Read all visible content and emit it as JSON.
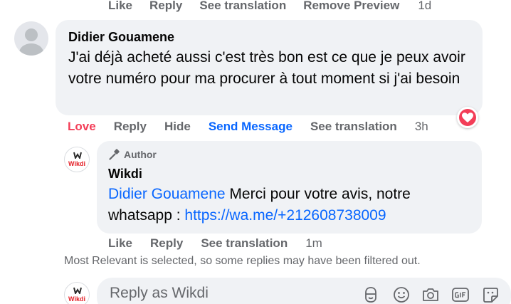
{
  "top_actions": {
    "like": "Like",
    "reply": "Reply",
    "see_translation": "See translation",
    "remove_preview": "Remove Preview",
    "time": "1d"
  },
  "comment": {
    "author": "Didier Gouamene",
    "text": "J'ai déjà acheté aussi c'est très bon est ce que je peux avoir votre numéro pour ma procurer à tout moment si j'ai besoin",
    "reaction_icon": "heart-love",
    "actions": {
      "love": "Love",
      "reply": "Reply",
      "hide": "Hide",
      "send_message": "Send Message",
      "see_translation": "See translation",
      "time": "3h"
    }
  },
  "reply": {
    "badge": "Author",
    "author": "Wikdi",
    "logo_text": "Wikdi",
    "mention": "Didier Gouamene",
    "text": " Merci pour votre avis, notre whatsapp : ",
    "link": "https://wa.me/+212608738009",
    "actions": {
      "like": "Like",
      "reply": "Reply",
      "see_translation": "See translation",
      "time": "1m"
    }
  },
  "notice": "Most Relevant is selected, so some replies may have been filtered out.",
  "composer": {
    "placeholder": "Reply as Wikdi",
    "logo_text": "Wikdi",
    "tools": [
      "avatar-sticker-icon",
      "emoji-icon",
      "camera-icon",
      "gif-icon",
      "sticker-icon"
    ]
  },
  "colors": {
    "bubble": "#f0f2f5",
    "secondary_text": "#65676b",
    "link_blue": "#0866ff",
    "love_red": "#f33e58",
    "brand_red": "#e41e26"
  }
}
